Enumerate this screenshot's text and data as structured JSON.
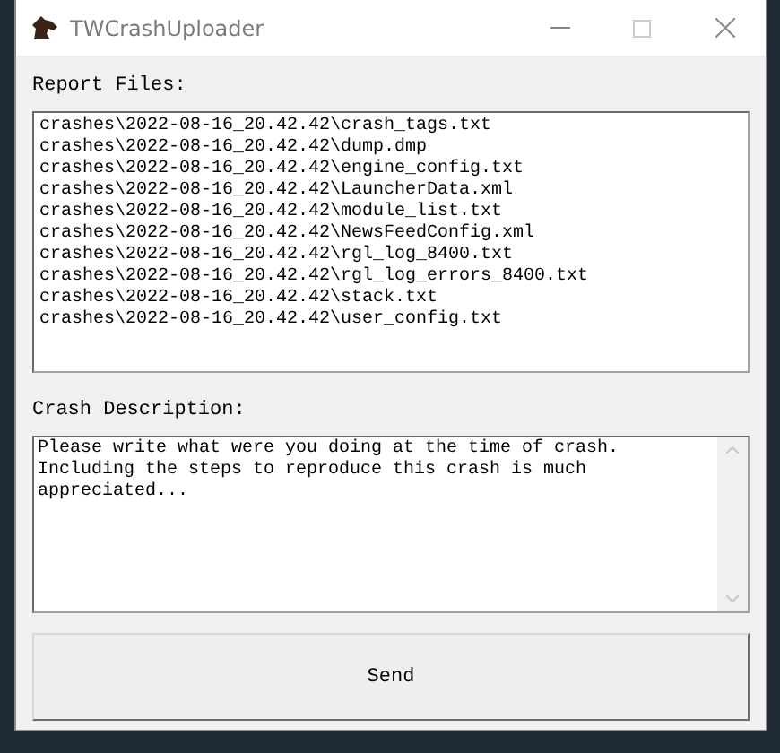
{
  "window": {
    "title": "TWCrashUploader"
  },
  "report_files": {
    "label": "Report Files:",
    "files": [
      "crashes\\2022-08-16_20.42.42\\crash_tags.txt",
      "crashes\\2022-08-16_20.42.42\\dump.dmp",
      "crashes\\2022-08-16_20.42.42\\engine_config.txt",
      "crashes\\2022-08-16_20.42.42\\LauncherData.xml",
      "crashes\\2022-08-16_20.42.42\\module_list.txt",
      "crashes\\2022-08-16_20.42.42\\NewsFeedConfig.xml",
      "crashes\\2022-08-16_20.42.42\\rgl_log_8400.txt",
      "crashes\\2022-08-16_20.42.42\\rgl_log_errors_8400.txt",
      "crashes\\2022-08-16_20.42.42\\stack.txt",
      "crashes\\2022-08-16_20.42.42\\user_config.txt"
    ]
  },
  "crash_description": {
    "label": "Crash Description:",
    "value": "Please write what were you doing at the time of crash.\nIncluding the steps to reproduce this crash is much\nappreciated..."
  },
  "buttons": [
    "Send"
  ]
}
